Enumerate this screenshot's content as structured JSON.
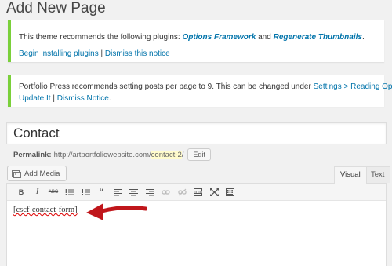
{
  "page": {
    "title": "Add New Page"
  },
  "notice1": {
    "pre": "This theme recommends the following plugins: ",
    "plugin1": "Options Framework",
    "and": " and ",
    "plugin2": "Regenerate Thumbnails",
    "post": ".",
    "install_link": "Begin installing plugins",
    "separator": " | ",
    "dismiss_link": "Dismiss this notice"
  },
  "notice2": {
    "text": "Portfolio Press recommends setting posts per page to 9. This can be changed under ",
    "settings_link": "Settings > Reading Options",
    "period": ".",
    "update_link": "Update It",
    "separator": " | ",
    "dismiss_link": "Dismiss Notice",
    "post": "."
  },
  "post": {
    "title": "Contact",
    "permalink_label": "Permalink:",
    "permalink_base": "http://artportfoliowebsite.com/",
    "slug": "contact-2",
    "slash": "/",
    "edit_label": "Edit"
  },
  "editor": {
    "add_media": "Add Media",
    "tab_visual": "Visual",
    "tab_text": "Text",
    "content": "[cscf-contact-form]",
    "toolbar": [
      "bold-icon",
      "italic-icon",
      "strikethrough-icon",
      "bullet-list-icon",
      "numbered-list-icon",
      "blockquote-icon",
      "align-left-icon",
      "align-center-icon",
      "align-right-icon",
      "insert-link-icon",
      "remove-link-icon",
      "insert-more-icon",
      "fullscreen-icon",
      "toolbar-toggle-icon"
    ]
  },
  "colors": {
    "notice_border": "#7ad03a",
    "link": "#0073aa",
    "arrow": "#c0161b"
  }
}
